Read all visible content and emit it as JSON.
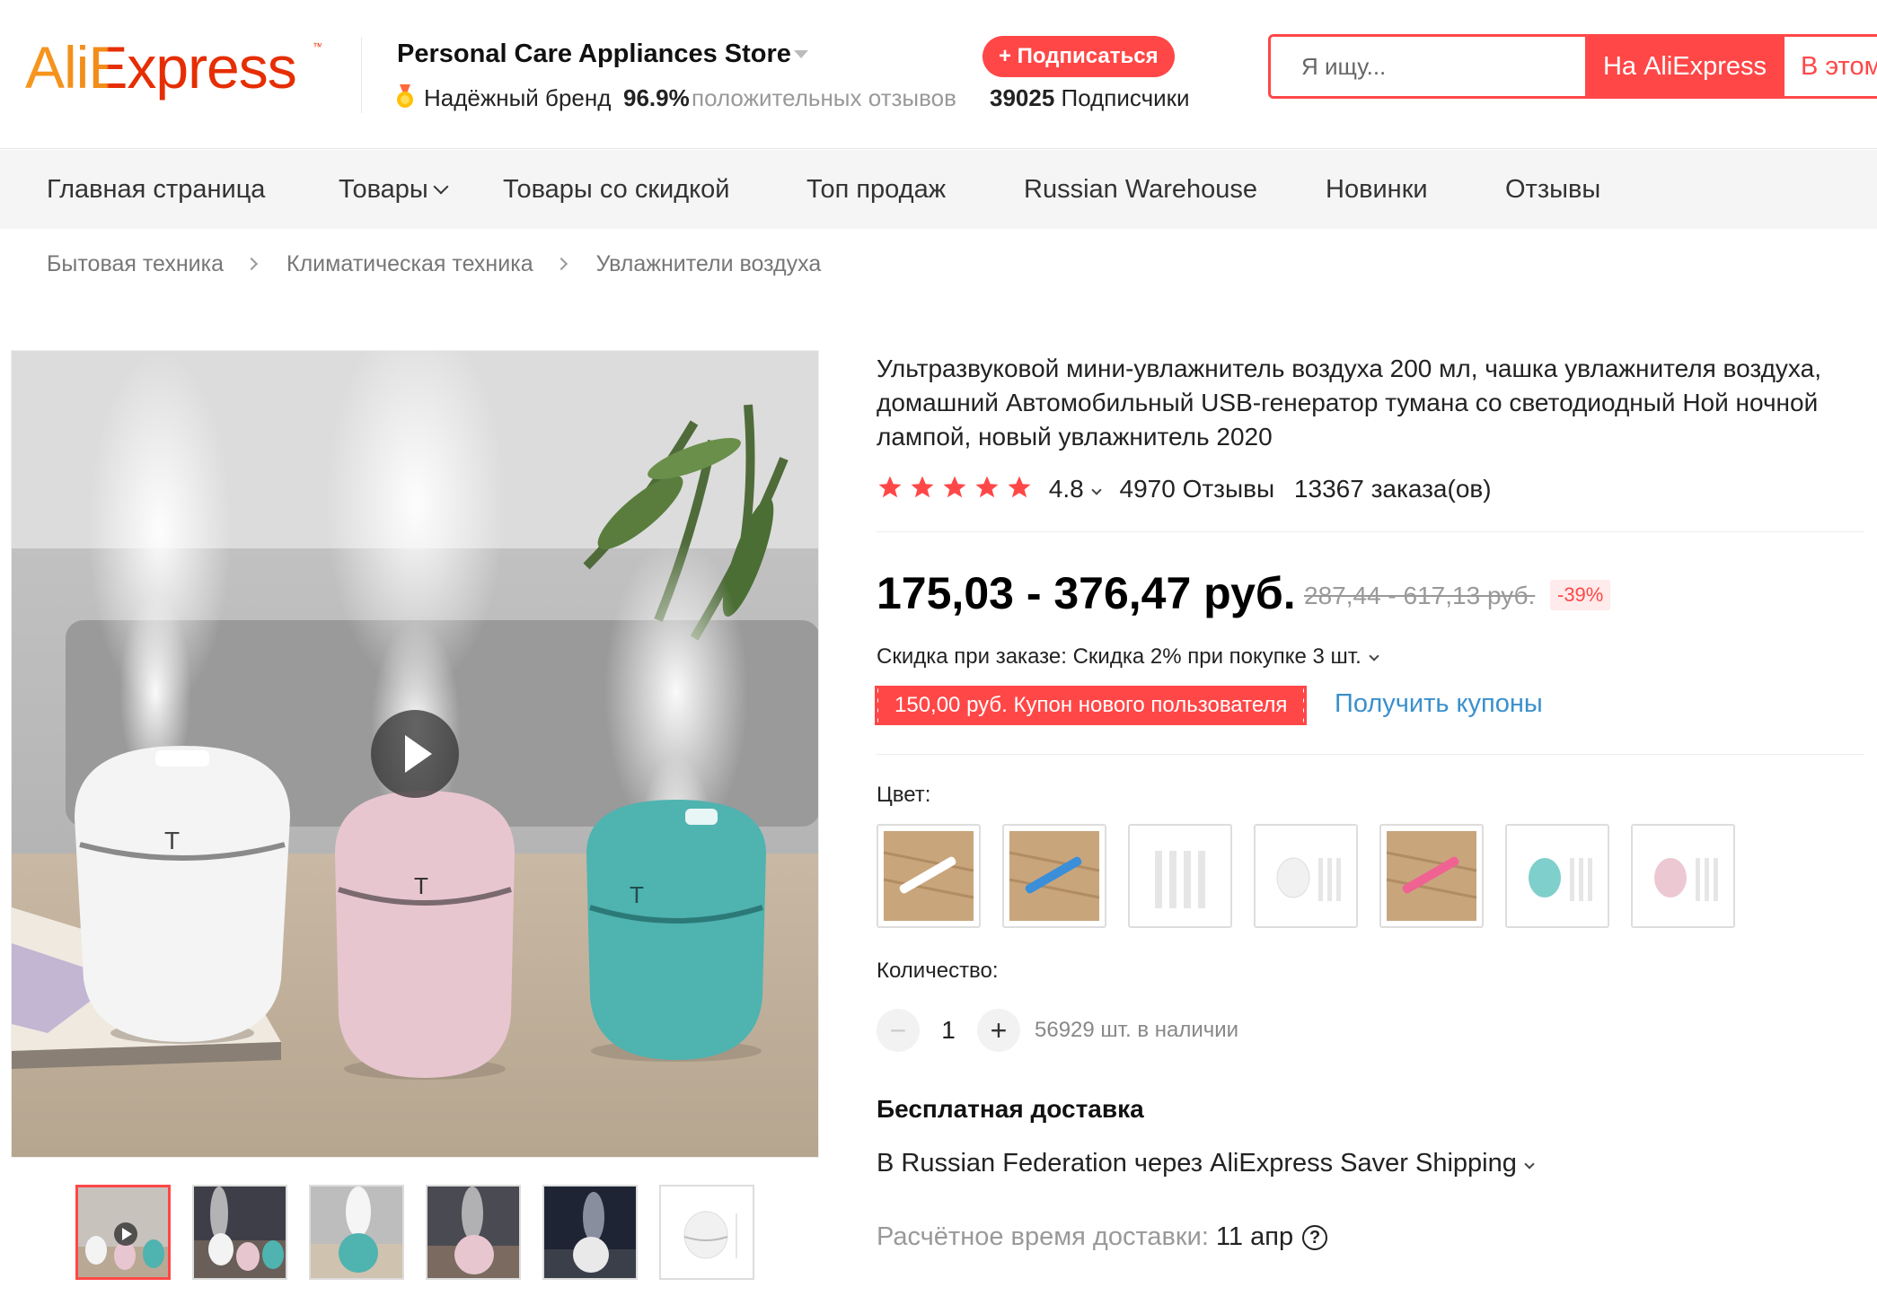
{
  "header": {
    "logo_part1": "Ali",
    "logo_part2": "Express",
    "store_name": "Personal Care Appliances Store",
    "trusted_brand": "Надёжный бренд",
    "positive_pct": "96.9%",
    "positive_text": "положительных отзывов",
    "subscribe_label": "+ Подписаться",
    "followers_count": "39025",
    "followers_label": "Подписчики",
    "search_placeholder": "Я ищу...",
    "search_ali_label": "На AliExpress",
    "search_store_label": "В этом"
  },
  "nav": {
    "items": [
      "Главная страница",
      "Товары",
      "Товары со скидкой",
      "Топ продаж",
      "Russian Warehouse",
      "Новинки",
      "Отзывы"
    ]
  },
  "breadcrumb": [
    "Бытовая техника",
    "Климатическая техника",
    "Увлажнители воздуха"
  ],
  "product": {
    "title": "Ультразвуковой мини-увлажнитель воздуха 200 мл, чашка увлажнителя воздуха, домашний Автомобильный USB-генератор тумана со светодиодный Ной ночной лампой, новый увлажнитель 2020",
    "rating": "4.8",
    "reviews": "4970 Отзывы",
    "orders": "13367 заказа(ов)",
    "price": "175,03 - 376,47 руб.",
    "old_price": "287,44 - 617,13 руб.",
    "discount": "-39%",
    "bulk_discount": "Скидка при заказе: Скидка 2% при покупке 3 шт.",
    "coupon": "150,00 руб. Купон нового пользователя",
    "get_coupons": "Получить купоны",
    "color_label": "Цвет:",
    "quantity_label": "Количество:",
    "quantity": "1",
    "minus": "−",
    "plus": "+",
    "stock": "56929 шт. в наличии",
    "shipping_title": "Бесплатная доставка",
    "shipping_route": "В Russian Federation через AliExpress Saver Shipping",
    "delivery_label": "Расчётное время доставки:",
    "delivery_date": "11 апр",
    "help": "?"
  },
  "colors": {
    "accent": "#ff4747",
    "logo_orange": "#e62e04",
    "link": "#3a90cc",
    "star": "#ff4747"
  }
}
